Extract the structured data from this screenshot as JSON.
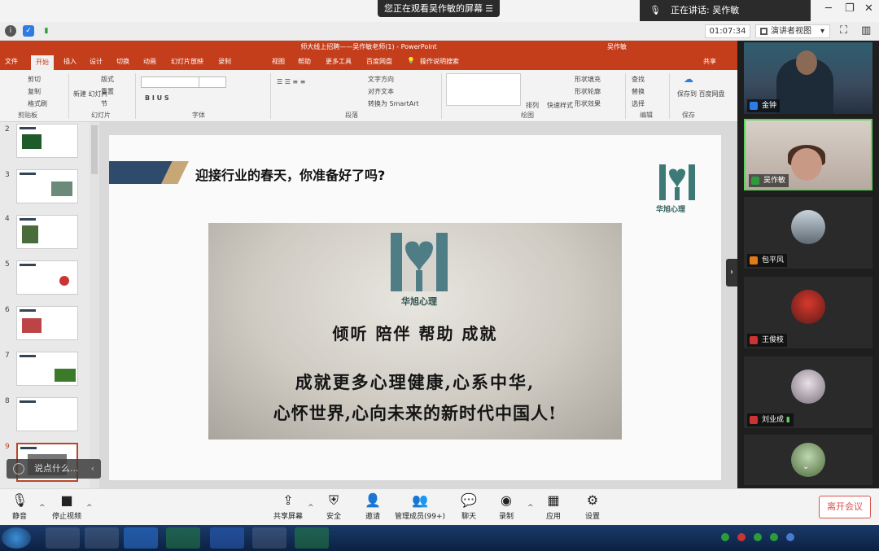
{
  "zoom": {
    "share_banner": "您正在观看吴作敏的屏幕",
    "speaking_label": "正在讲话: 吴作敏",
    "timer": "01:07:34",
    "view_button": "演讲者视图",
    "comment_placeholder": "说点什么..."
  },
  "ppt": {
    "window_title": "师大线上招聘——吴作敏老师(1) - PowerPoint",
    "user": "吴作敏",
    "tabs": [
      "文件",
      "开始",
      "插入",
      "设计",
      "切换",
      "动画",
      "幻灯片放映",
      "录制",
      "视图",
      "帮助",
      "更多工具",
      "百度网盘",
      "操作说明搜索"
    ],
    "share": "共享",
    "ribbon": {
      "cut": "剪切",
      "copy": "复制",
      "format_painter": "格式刷",
      "clipboard": "剪贴板",
      "new_slide": "新建\n幻灯片",
      "layout": "版式",
      "reset": "重置",
      "section": "节",
      "slides": "幻灯片",
      "font": "字体",
      "paragraph": "段落",
      "text_direction": "文字方向",
      "align_text": "对齐文本",
      "smartart": "转换为 SmartArt",
      "drawing": "绘图",
      "arrange": "排列",
      "quick_styles": "快速样式",
      "shape_fill": "形状填充",
      "shape_outline": "形状轮廓",
      "shape_effects": "形状效果",
      "find": "查找",
      "replace": "替换",
      "select": "选择",
      "editing": "编辑",
      "save_baidu": "保存到\n百度网盘",
      "save": "保存"
    },
    "thumbnail_numbers": [
      "2",
      "3",
      "4",
      "5",
      "6",
      "7",
      "8",
      "9"
    ],
    "slide": {
      "title": "迎接行业的春天，你准备好了吗?",
      "logo_caption": "华旭心理",
      "motto": "倾听 陪伴 帮助 成就",
      "line1": "成就更多心理健康,心系中华,",
      "line2": "心怀世界,心向未来的新时代中国人!"
    }
  },
  "participants": [
    {
      "name": "金钟"
    },
    {
      "name": "吴作敏"
    },
    {
      "name": "包平风"
    },
    {
      "name": "王俊枝"
    },
    {
      "name": "刘业成"
    }
  ],
  "controls": {
    "mute": "静音",
    "stop_video": "停止视频",
    "share_screen": "共享屏幕",
    "security": "安全",
    "invite": "邀请",
    "participants": "管理成员(99+)",
    "chat": "聊天",
    "record": "录制",
    "apps": "应用",
    "settings": "设置",
    "leave": "离开会议"
  },
  "colors": {
    "ppt_accent": "#c43e1c",
    "active_speaker": "#5cd65c",
    "leave": "#d9534f"
  }
}
